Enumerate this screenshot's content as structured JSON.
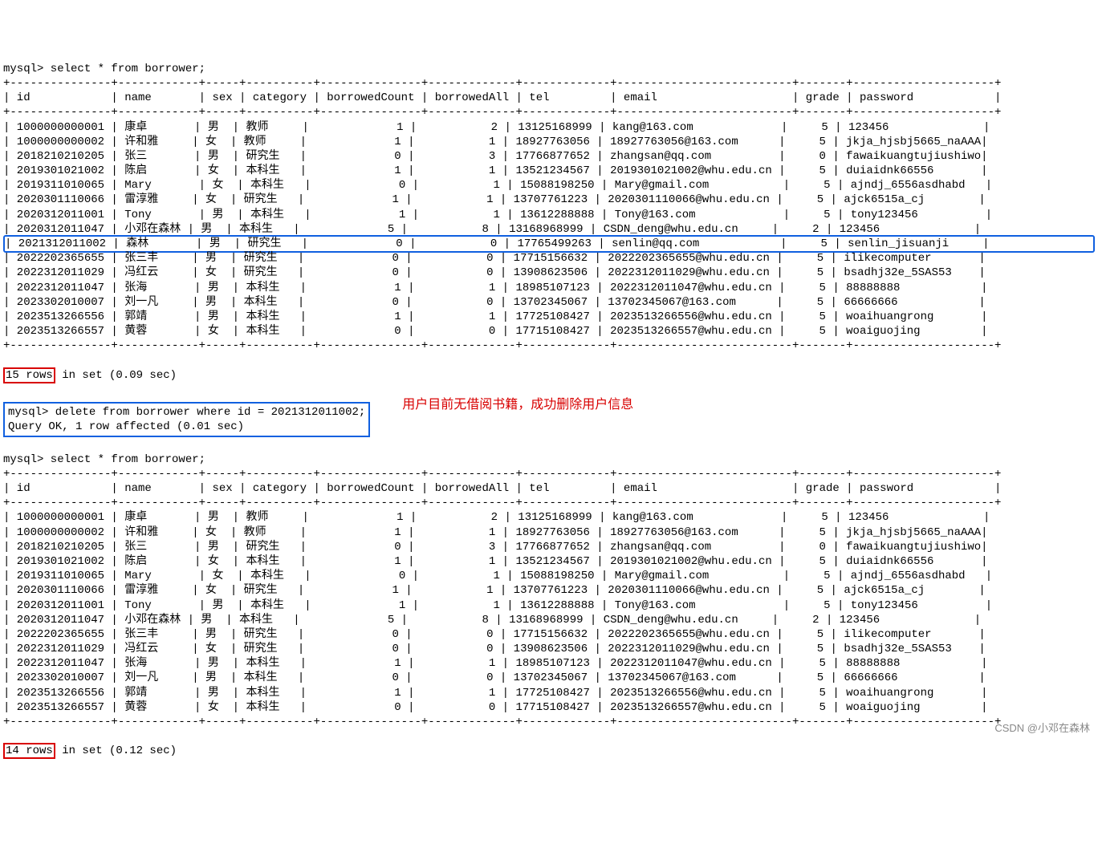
{
  "widths": {
    "id": 15,
    "name": 12,
    "sex": 5,
    "category": 10,
    "borrowedCount": 15,
    "borrowedAll": 13,
    "tel": 13,
    "email": 26,
    "grade": 7,
    "password": 21
  },
  "headers": [
    "id",
    "name",
    "sex",
    "category",
    "borrowedCount",
    "borrowedAll",
    "tel",
    "email",
    "grade",
    "password"
  ],
  "numeric_cols": [
    "borrowedCount",
    "borrowedAll",
    "grade"
  ],
  "prompt1": "mysql> select * from borrower;",
  "rows1": [
    {
      "id": "1000000000001",
      "name": "康卓",
      "sex": "男",
      "category": "教师",
      "borrowedCount": "1",
      "borrowedAll": "2",
      "tel": "13125168999",
      "email": "kang@163.com",
      "grade": "5",
      "password": "123456"
    },
    {
      "id": "1000000000002",
      "name": "许和雅",
      "sex": "女",
      "category": "教师",
      "borrowedCount": "1",
      "borrowedAll": "1",
      "tel": "18927763056",
      "email": "18927763056@163.com",
      "grade": "5",
      "password": "jkja_hjsbj5665_naAAA"
    },
    {
      "id": "2018210210205",
      "name": "张三",
      "sex": "男",
      "category": "研究生",
      "borrowedCount": "0",
      "borrowedAll": "3",
      "tel": "17766877652",
      "email": "zhangsan@qq.com",
      "grade": "0",
      "password": "fawaikuangtujiushiwo"
    },
    {
      "id": "2019301021002",
      "name": "陈启",
      "sex": "女",
      "category": "本科生",
      "borrowedCount": "1",
      "borrowedAll": "1",
      "tel": "13521234567",
      "email": "2019301021002@whu.edu.cn",
      "grade": "5",
      "password": "duiaidnk66556"
    },
    {
      "id": "2019311010065",
      "name": "Mary",
      "sex": "女",
      "category": "本科生",
      "borrowedCount": "0",
      "borrowedAll": "1",
      "tel": "15088198250",
      "email": "Mary@gmail.com",
      "grade": "5",
      "password": "ajndj_6556asdhabd"
    },
    {
      "id": "2020301110066",
      "name": "雷淳雅",
      "sex": "女",
      "category": "研究生",
      "borrowedCount": "1",
      "borrowedAll": "1",
      "tel": "13707761223",
      "email": "2020301110066@whu.edu.cn",
      "grade": "5",
      "password": "ajck6515a_cj"
    },
    {
      "id": "2020312011001",
      "name": "Tony",
      "sex": "男",
      "category": "本科生",
      "borrowedCount": "1",
      "borrowedAll": "1",
      "tel": "13612288888",
      "email": "Tony@163.com",
      "grade": "5",
      "password": "tony123456"
    },
    {
      "id": "2020312011047",
      "name": "小邓在森林",
      "sex": "男",
      "category": "本科生",
      "borrowedCount": "5",
      "borrowedAll": "8",
      "tel": "13168968999",
      "email": "CSDN_deng@whu.edu.cn",
      "grade": "2",
      "password": "123456"
    },
    {
      "id": "2021312011002",
      "name": "森林",
      "sex": "男",
      "category": "研究生",
      "borrowedCount": "0",
      "borrowedAll": "0",
      "tel": "17765499263",
      "email": "senlin@qq.com",
      "grade": "5",
      "password": "senlin_jisuanji",
      "_highlight": true
    },
    {
      "id": "2022202365655",
      "name": "张三丰",
      "sex": "男",
      "category": "研究生",
      "borrowedCount": "0",
      "borrowedAll": "0",
      "tel": "17715156632",
      "email": "2022202365655@whu.edu.cn",
      "grade": "5",
      "password": "ilikecomputer"
    },
    {
      "id": "2022312011029",
      "name": "冯红云",
      "sex": "女",
      "category": "研究生",
      "borrowedCount": "0",
      "borrowedAll": "0",
      "tel": "13908623506",
      "email": "2022312011029@whu.edu.cn",
      "grade": "5",
      "password": "bsadhj32e_5SAS53"
    },
    {
      "id": "2022312011047",
      "name": "张海",
      "sex": "男",
      "category": "本科生",
      "borrowedCount": "1",
      "borrowedAll": "1",
      "tel": "18985107123",
      "email": "2022312011047@whu.edu.cn",
      "grade": "5",
      "password": "88888888"
    },
    {
      "id": "2023302010007",
      "name": "刘一凡",
      "sex": "男",
      "category": "本科生",
      "borrowedCount": "0",
      "borrowedAll": "0",
      "tel": "13702345067",
      "email": "13702345067@163.com",
      "grade": "5",
      "password": "66666666"
    },
    {
      "id": "2023513266556",
      "name": "郭靖",
      "sex": "男",
      "category": "本科生",
      "borrowedCount": "1",
      "borrowedAll": "1",
      "tel": "17725108427",
      "email": "2023513266556@whu.edu.cn",
      "grade": "5",
      "password": "woaihuangrong"
    },
    {
      "id": "2023513266557",
      "name": "黄蓉",
      "sex": "女",
      "category": "本科生",
      "borrowedCount": "0",
      "borrowedAll": "0",
      "tel": "17715108427",
      "email": "2023513266557@whu.edu.cn",
      "grade": "5",
      "password": "woaiguojing"
    }
  ],
  "summary1_count": "15 rows",
  "summary1_rest": " in set (0.09 sec)",
  "delete_cmd": "mysql> delete from borrower where id = 2021312011002;\nQuery OK, 1 row affected (0.01 sec)",
  "red_note": "用户目前无借阅书籍，成功删除用户信息",
  "prompt2": "mysql> select * from borrower;",
  "rows2": [
    {
      "id": "1000000000001",
      "name": "康卓",
      "sex": "男",
      "category": "教师",
      "borrowedCount": "1",
      "borrowedAll": "2",
      "tel": "13125168999",
      "email": "kang@163.com",
      "grade": "5",
      "password": "123456"
    },
    {
      "id": "1000000000002",
      "name": "许和雅",
      "sex": "女",
      "category": "教师",
      "borrowedCount": "1",
      "borrowedAll": "1",
      "tel": "18927763056",
      "email": "18927763056@163.com",
      "grade": "5",
      "password": "jkja_hjsbj5665_naAAA"
    },
    {
      "id": "2018210210205",
      "name": "张三",
      "sex": "男",
      "category": "研究生",
      "borrowedCount": "0",
      "borrowedAll": "3",
      "tel": "17766877652",
      "email": "zhangsan@qq.com",
      "grade": "0",
      "password": "fawaikuangtujiushiwo"
    },
    {
      "id": "2019301021002",
      "name": "陈启",
      "sex": "女",
      "category": "本科生",
      "borrowedCount": "1",
      "borrowedAll": "1",
      "tel": "13521234567",
      "email": "2019301021002@whu.edu.cn",
      "grade": "5",
      "password": "duiaidnk66556"
    },
    {
      "id": "2019311010065",
      "name": "Mary",
      "sex": "女",
      "category": "本科生",
      "borrowedCount": "0",
      "borrowedAll": "1",
      "tel": "15088198250",
      "email": "Mary@gmail.com",
      "grade": "5",
      "password": "ajndj_6556asdhabd"
    },
    {
      "id": "2020301110066",
      "name": "雷淳雅",
      "sex": "女",
      "category": "研究生",
      "borrowedCount": "1",
      "borrowedAll": "1",
      "tel": "13707761223",
      "email": "2020301110066@whu.edu.cn",
      "grade": "5",
      "password": "ajck6515a_cj"
    },
    {
      "id": "2020312011001",
      "name": "Tony",
      "sex": "男",
      "category": "本科生",
      "borrowedCount": "1",
      "borrowedAll": "1",
      "tel": "13612288888",
      "email": "Tony@163.com",
      "grade": "5",
      "password": "tony123456"
    },
    {
      "id": "2020312011047",
      "name": "小邓在森林",
      "sex": "男",
      "category": "本科生",
      "borrowedCount": "5",
      "borrowedAll": "8",
      "tel": "13168968999",
      "email": "CSDN_deng@whu.edu.cn",
      "grade": "2",
      "password": "123456"
    },
    {
      "id": "2022202365655",
      "name": "张三丰",
      "sex": "男",
      "category": "研究生",
      "borrowedCount": "0",
      "borrowedAll": "0",
      "tel": "17715156632",
      "email": "2022202365655@whu.edu.cn",
      "grade": "5",
      "password": "ilikecomputer"
    },
    {
      "id": "2022312011029",
      "name": "冯红云",
      "sex": "女",
      "category": "研究生",
      "borrowedCount": "0",
      "borrowedAll": "0",
      "tel": "13908623506",
      "email": "2022312011029@whu.edu.cn",
      "grade": "5",
      "password": "bsadhj32e_5SAS53"
    },
    {
      "id": "2022312011047",
      "name": "张海",
      "sex": "男",
      "category": "本科生",
      "borrowedCount": "1",
      "borrowedAll": "1",
      "tel": "18985107123",
      "email": "2022312011047@whu.edu.cn",
      "grade": "5",
      "password": "88888888"
    },
    {
      "id": "2023302010007",
      "name": "刘一凡",
      "sex": "男",
      "category": "本科生",
      "borrowedCount": "0",
      "borrowedAll": "0",
      "tel": "13702345067",
      "email": "13702345067@163.com",
      "grade": "5",
      "password": "66666666"
    },
    {
      "id": "2023513266556",
      "name": "郭靖",
      "sex": "男",
      "category": "本科生",
      "borrowedCount": "1",
      "borrowedAll": "1",
      "tel": "17725108427",
      "email": "2023513266556@whu.edu.cn",
      "grade": "5",
      "password": "woaihuangrong"
    },
    {
      "id": "2023513266557",
      "name": "黄蓉",
      "sex": "女",
      "category": "本科生",
      "borrowedCount": "0",
      "borrowedAll": "0",
      "tel": "17715108427",
      "email": "2023513266557@whu.edu.cn",
      "grade": "5",
      "password": "woaiguojing"
    }
  ],
  "summary2_count": "14 rows",
  "summary2_rest": " in set (0.12 sec)",
  "footer": "CSDN @小邓在森林"
}
